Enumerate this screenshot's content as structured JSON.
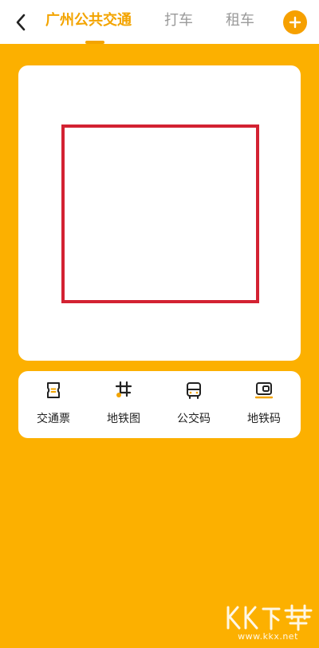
{
  "header": {
    "tabs": [
      {
        "label": "广州公共交通",
        "active": true
      },
      {
        "label": "打车",
        "active": false
      },
      {
        "label": "租车",
        "active": false
      }
    ],
    "back_icon": "chevron-left-icon",
    "add_icon": "plus-circle-icon"
  },
  "qr_panel": {
    "frame_color": "#D32232"
  },
  "functions": [
    {
      "label": "交通票",
      "icon": "ticket-icon"
    },
    {
      "label": "地铁图",
      "icon": "metro-map-icon"
    },
    {
      "label": "公交码",
      "icon": "bus-icon"
    },
    {
      "label": "地铁码",
      "icon": "metro-card-icon"
    }
  ],
  "watermark": {
    "logo_text": "KK下载",
    "url": "www.kkx.net"
  },
  "colors": {
    "background": "#FCB000",
    "accent": "#F3A400",
    "highlight_frame": "#D32232"
  }
}
